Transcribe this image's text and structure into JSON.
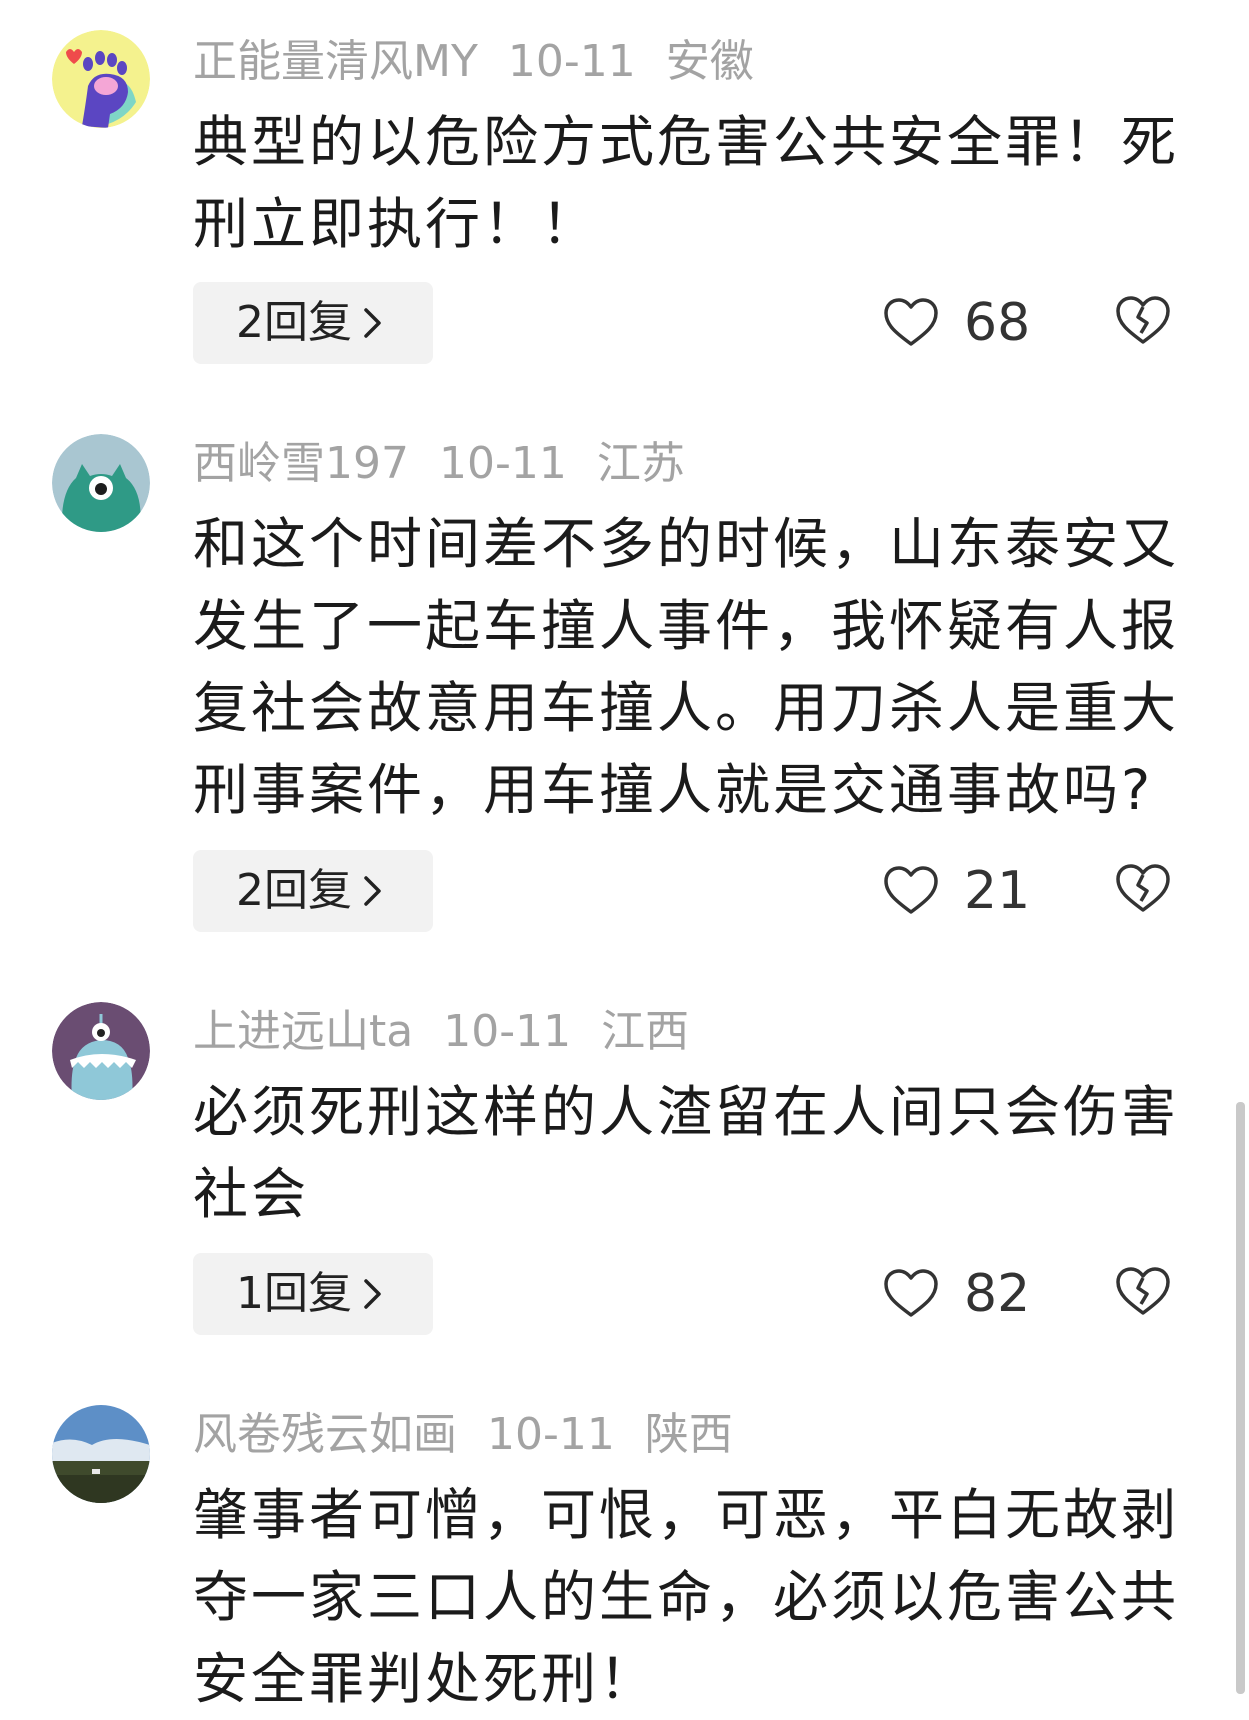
{
  "comments": [
    {
      "username": "正能量清风MY",
      "date": "10-11",
      "location": "安徽",
      "avatar_icon": "paw-icon",
      "text": "典型的以危险方式危害公共安全罪！死刑立即执行！！",
      "reply_label": "2回复",
      "likes": "68"
    },
    {
      "username": "西岭雪197",
      "date": "10-11",
      "location": "江苏",
      "avatar_icon": "one-eyed-monster-icon",
      "text": "和这个时间差不多的时候，山东泰安又发生了一起车撞人事件，我怀疑有人报复社会故意用车撞人。用刀杀人是重大刑事案件，用车撞人就是交通事故吗?",
      "reply_label": "2回复",
      "likes": "21"
    },
    {
      "username": "上进远山ta",
      "date": "10-11",
      "location": "江西",
      "avatar_icon": "dinosaur-icon",
      "text": "必须死刑这样的人渣留在人间只会伤害社会",
      "reply_label": "1回复",
      "likes": "82"
    },
    {
      "username": "风卷残云如画",
      "date": "10-11",
      "location": "陕西",
      "avatar_icon": "landscape-photo-icon",
      "text": "肇事者可憎，可恨，可恶，平白无故剥夺一家三口人的生命，必须以危害公共安全罪判处死刑！",
      "reply_label": "",
      "likes": ""
    }
  ],
  "colors": {
    "meta_text": "#a3a3a3",
    "body_text": "#1b1b1b",
    "reply_bg": "#f2f2f2",
    "icon_stroke": "#333333"
  }
}
